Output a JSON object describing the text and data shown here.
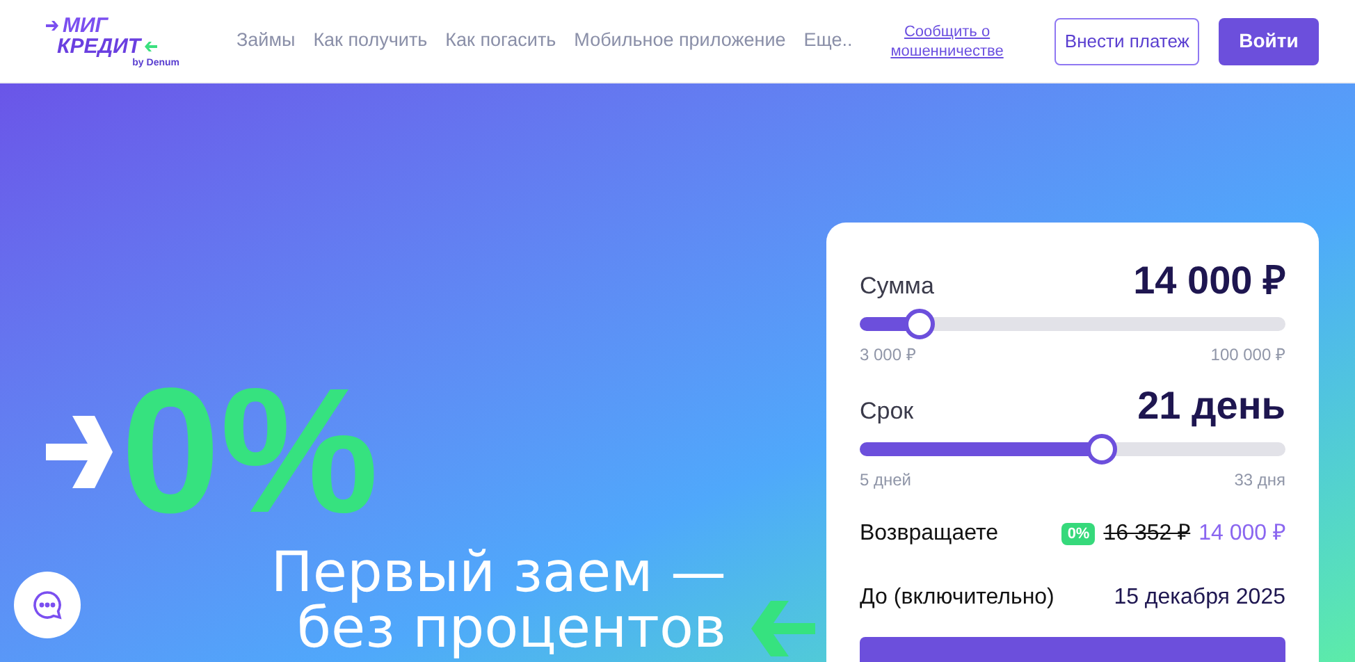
{
  "logo": {
    "line_1": "МИГ",
    "line_2": "КРЕДИТ",
    "byline": "by Denum"
  },
  "nav": [
    {
      "label": "Займы"
    },
    {
      "label": "Как получить"
    },
    {
      "label": "Как погасить"
    },
    {
      "label": "Мобильное приложение"
    },
    {
      "label": "Еще.."
    }
  ],
  "fraud_link": "Сообщить о мошенничестве",
  "buttons": {
    "pay": "Внести платеж",
    "login": "Войти"
  },
  "hero": {
    "rate": "0%",
    "headline_1": "Первый заем —",
    "headline_2": "без процентов"
  },
  "calculator": {
    "sliders": [
      {
        "label": "Сумма",
        "value": "14 000 ₽",
        "level": 0.14,
        "min": "3 000 ₽",
        "max": "100 000 ₽"
      },
      {
        "label": "Срок",
        "value": "21 день",
        "level": 0.57,
        "min": "5 дней",
        "max": "33 дня"
      }
    ],
    "repay_label": "Возвращаете",
    "repay_badge": "0%",
    "repay_old": "16 352 ₽",
    "repay_new": "14 000 ₽",
    "due_label": "До (включительно)",
    "due_date": "15 декабря 2025"
  }
}
